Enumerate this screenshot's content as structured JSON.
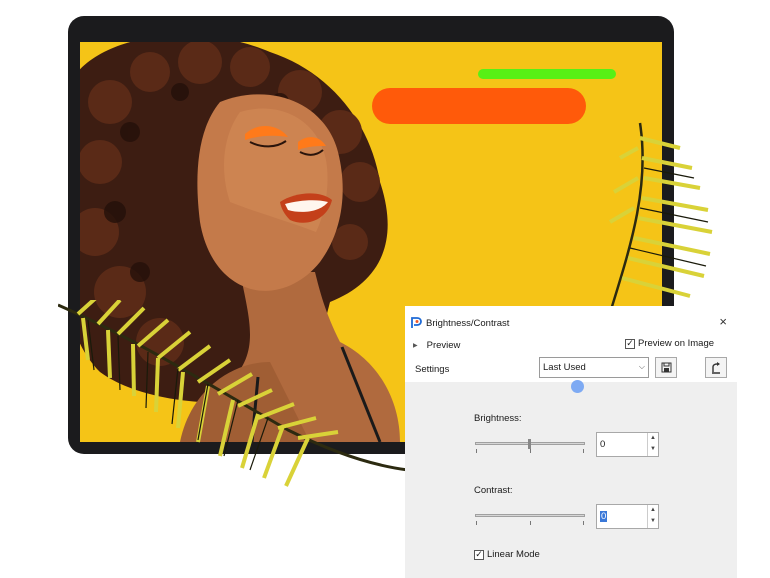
{
  "dialog": {
    "title": "Brightness/Contrast",
    "close_glyph": "×",
    "preview_label": "Preview",
    "preview_on_image_label": "Preview on Image",
    "preview_on_image_checked": true,
    "settings_label": "Settings",
    "settings_value": "Last Used",
    "brightness_label": "Brightness:",
    "brightness_value": "0",
    "contrast_label": "Contrast:",
    "contrast_value": "0",
    "linear_mode_label": "Linear Mode",
    "linear_mode_checked": true,
    "check_glyph": "✓"
  },
  "colors": {
    "background": "#f5c417",
    "green_accent": "#58f015",
    "orange_accent": "#ff5a0a",
    "selection": "#3a78d8",
    "drag_dot": "#7eaaf3"
  },
  "icons": {
    "expand": "triangle-right-icon",
    "combo": "chevron-down-icon",
    "save": "save-icon",
    "reset": "reset-icon",
    "app": "app-icon"
  }
}
